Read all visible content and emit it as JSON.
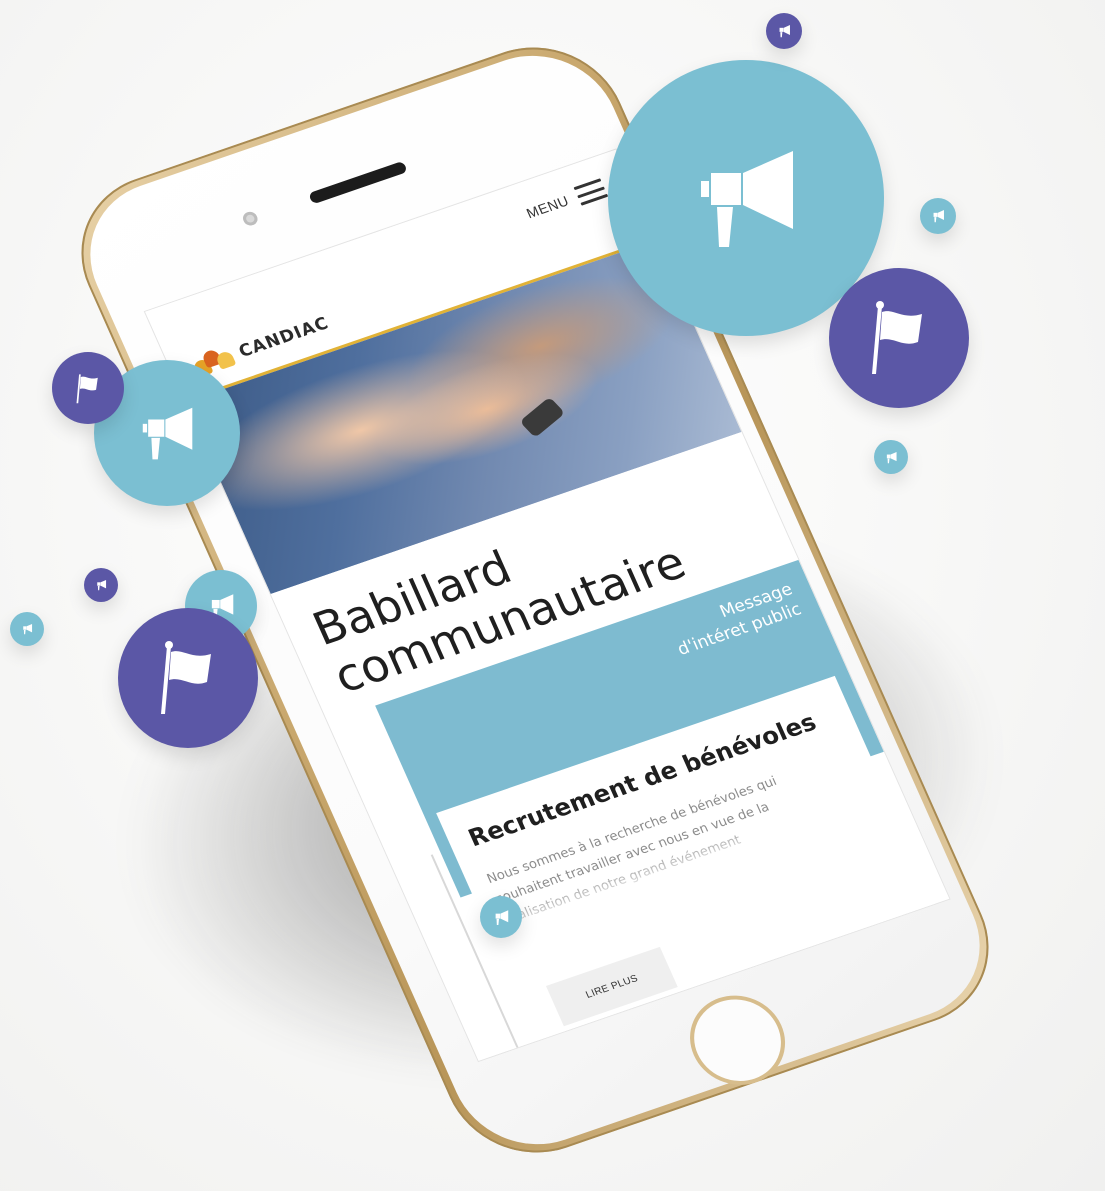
{
  "brand": {
    "name": "CANDIAC",
    "logo_colors": [
      "#e6a227",
      "#d9631f",
      "#f2c24b"
    ]
  },
  "header": {
    "menu_label": "MENU",
    "accent_color": "#e1b236"
  },
  "page": {
    "title_line1": "Babillard",
    "title_line2": "communautaire"
  },
  "category": {
    "line1": "Message",
    "line2": "d'intéret public",
    "color": "#7ebbd0"
  },
  "card": {
    "title": "Recrutement de bénévoles",
    "body_lines": [
      "Nous sommes à la recherche de bénévoles qui",
      "souhaitent travailler avec nous en vue de la",
      "réalisation de notre grand événement"
    ],
    "button_label": "LIRE PLUS"
  },
  "bubbles": {
    "teal_color": "#7bbfd2",
    "purple_color": "#5b57a6",
    "megaphone_icon": "megaphone-icon",
    "flag_icon": "flag-icon"
  }
}
